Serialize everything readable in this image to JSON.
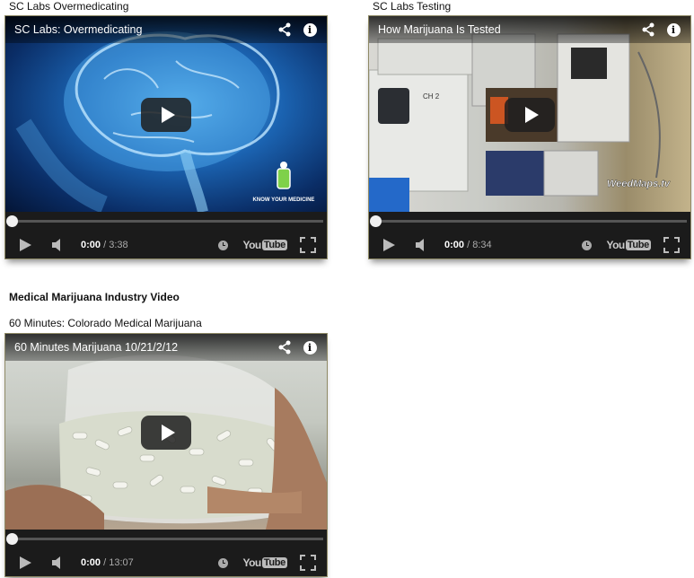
{
  "captions": {
    "video1": "SC Labs Overmedicating",
    "video2": "SC Labs Testing",
    "video3": "60 Minutes: Colorado Medical Marijuana"
  },
  "section_heading": "Medical Marijuana Industry Video",
  "videos": [
    {
      "title": "SC Labs: Overmedicating",
      "current_time": "0:00",
      "duration": "/ 3:38",
      "watermark": "KNOW YOUR MEDICINE"
    },
    {
      "title": "How Marijuana Is Tested",
      "current_time": "0:00",
      "duration": "/ 8:34",
      "watermark": "WeedMaps.tv"
    },
    {
      "title": "60 Minutes Marijuana 10/21/2/12",
      "current_time": "0:00",
      "duration": "/ 13:07"
    }
  ],
  "player": {
    "progress_fraction": 0,
    "logo_you": "You",
    "logo_tube": "Tube"
  },
  "icons": [
    "share-icon",
    "info-icon",
    "play-icon",
    "volume-icon",
    "watch-later-icon",
    "youtube-logo",
    "fullscreen-icon"
  ],
  "colors": {
    "border": "#8f8a66",
    "bar": "#1b1b1b",
    "progress": "#cc181e"
  }
}
